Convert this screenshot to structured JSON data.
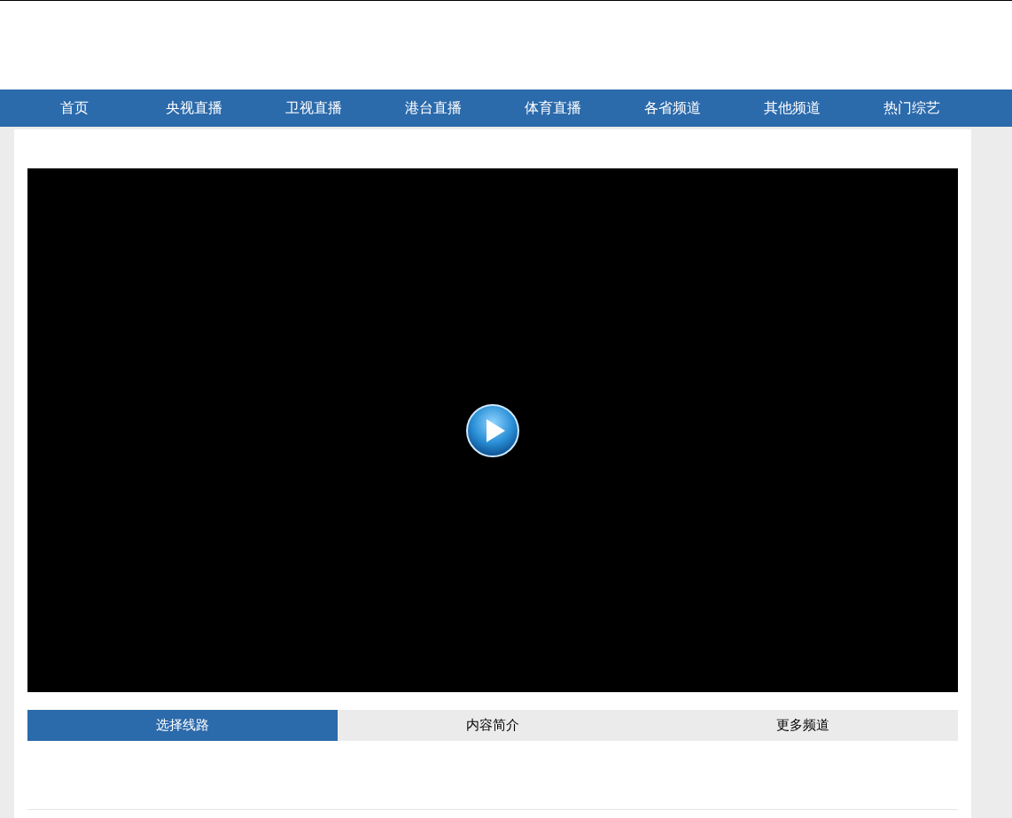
{
  "nav": [
    {
      "label": "首页"
    },
    {
      "label": "央视直播"
    },
    {
      "label": "卫视直播"
    },
    {
      "label": "港台直播"
    },
    {
      "label": "体育直播"
    },
    {
      "label": "各省频道"
    },
    {
      "label": "其他频道"
    },
    {
      "label": "热门综艺"
    }
  ],
  "player": {
    "kind": "video"
  },
  "tabs": [
    {
      "label": "选择线路",
      "selected": true
    },
    {
      "label": "内容简介",
      "selected": false
    },
    {
      "label": "更多频道",
      "selected": false
    }
  ]
}
